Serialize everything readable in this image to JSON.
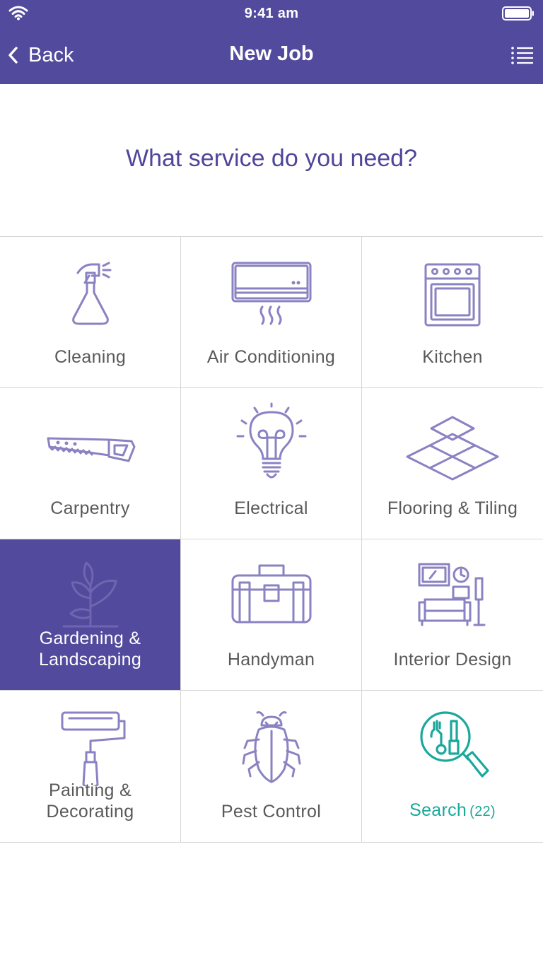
{
  "status_bar": {
    "time": "9:41 am"
  },
  "nav": {
    "back_label": "Back",
    "title": "New Job"
  },
  "question": "What service do you need?",
  "services": [
    {
      "label": "Cleaning",
      "icon": "spray-bottle-icon"
    },
    {
      "label": "Air Conditioning",
      "icon": "air-conditioner-icon"
    },
    {
      "label": "Kitchen",
      "icon": "oven-icon"
    },
    {
      "label": "Carpentry",
      "icon": "saw-icon"
    },
    {
      "label": "Electrical",
      "icon": "light-bulb-icon"
    },
    {
      "label": "Flooring & Tiling",
      "icon": "tiles-icon"
    },
    {
      "label": "Gardening & Landscaping",
      "icon": "plant-icon",
      "selected": true
    },
    {
      "label": "Handyman",
      "icon": "toolbox-icon"
    },
    {
      "label": "Interior Design",
      "icon": "living-room-icon"
    },
    {
      "label": "Painting & Decorating",
      "icon": "paint-roller-icon"
    },
    {
      "label": "Pest Control",
      "icon": "beetle-icon"
    },
    {
      "label": "Search",
      "count": "(22)",
      "icon": "search-tools-icon"
    }
  ],
  "colors": {
    "brand": "#524a9c",
    "question_text": "#4f4599",
    "icon_stroke": "#8a82c2",
    "search_accent": "#1aa89a",
    "label_text": "#595959"
  }
}
